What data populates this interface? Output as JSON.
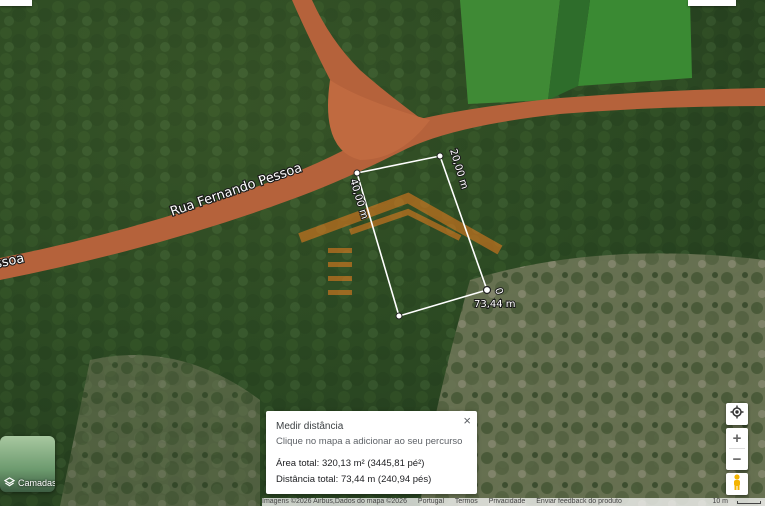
{
  "map": {
    "road_label": "Rua Fernando Pessoa",
    "road_label_cut": "ssoa",
    "measurements": {
      "top_edge": "20,00 m",
      "left_edge": "40,00 m",
      "end_label": "73,44 m",
      "corner_digit": "0"
    }
  },
  "layers": {
    "label": "Camadas",
    "icon": "layers-icon"
  },
  "measure_panel": {
    "title": "Medir distância",
    "hint": "Clique no mapa a adicionar ao seu percurso",
    "area": "Área total: 320,13 m² (3445,81 pé²)",
    "distance": "Distância total: 73,44 m (240,94 pés)",
    "close_icon": "close-icon"
  },
  "controls": {
    "locate_icon": "my-location-icon",
    "zoom_in": "+",
    "zoom_out": "−",
    "pegman_icon": "pegman-icon"
  },
  "footer": {
    "imagery": "Imagens ©2026 Airbus,Dados do mapa ©2026",
    "region": "Portugal",
    "terms": "Termos",
    "privacy": "Privacidade",
    "feedback": "Enviar feedback do produto",
    "scale": "10 m"
  },
  "colors": {
    "road": "#b5623b",
    "measure_line": "#ffffff",
    "watermark": "#e07a1f"
  }
}
